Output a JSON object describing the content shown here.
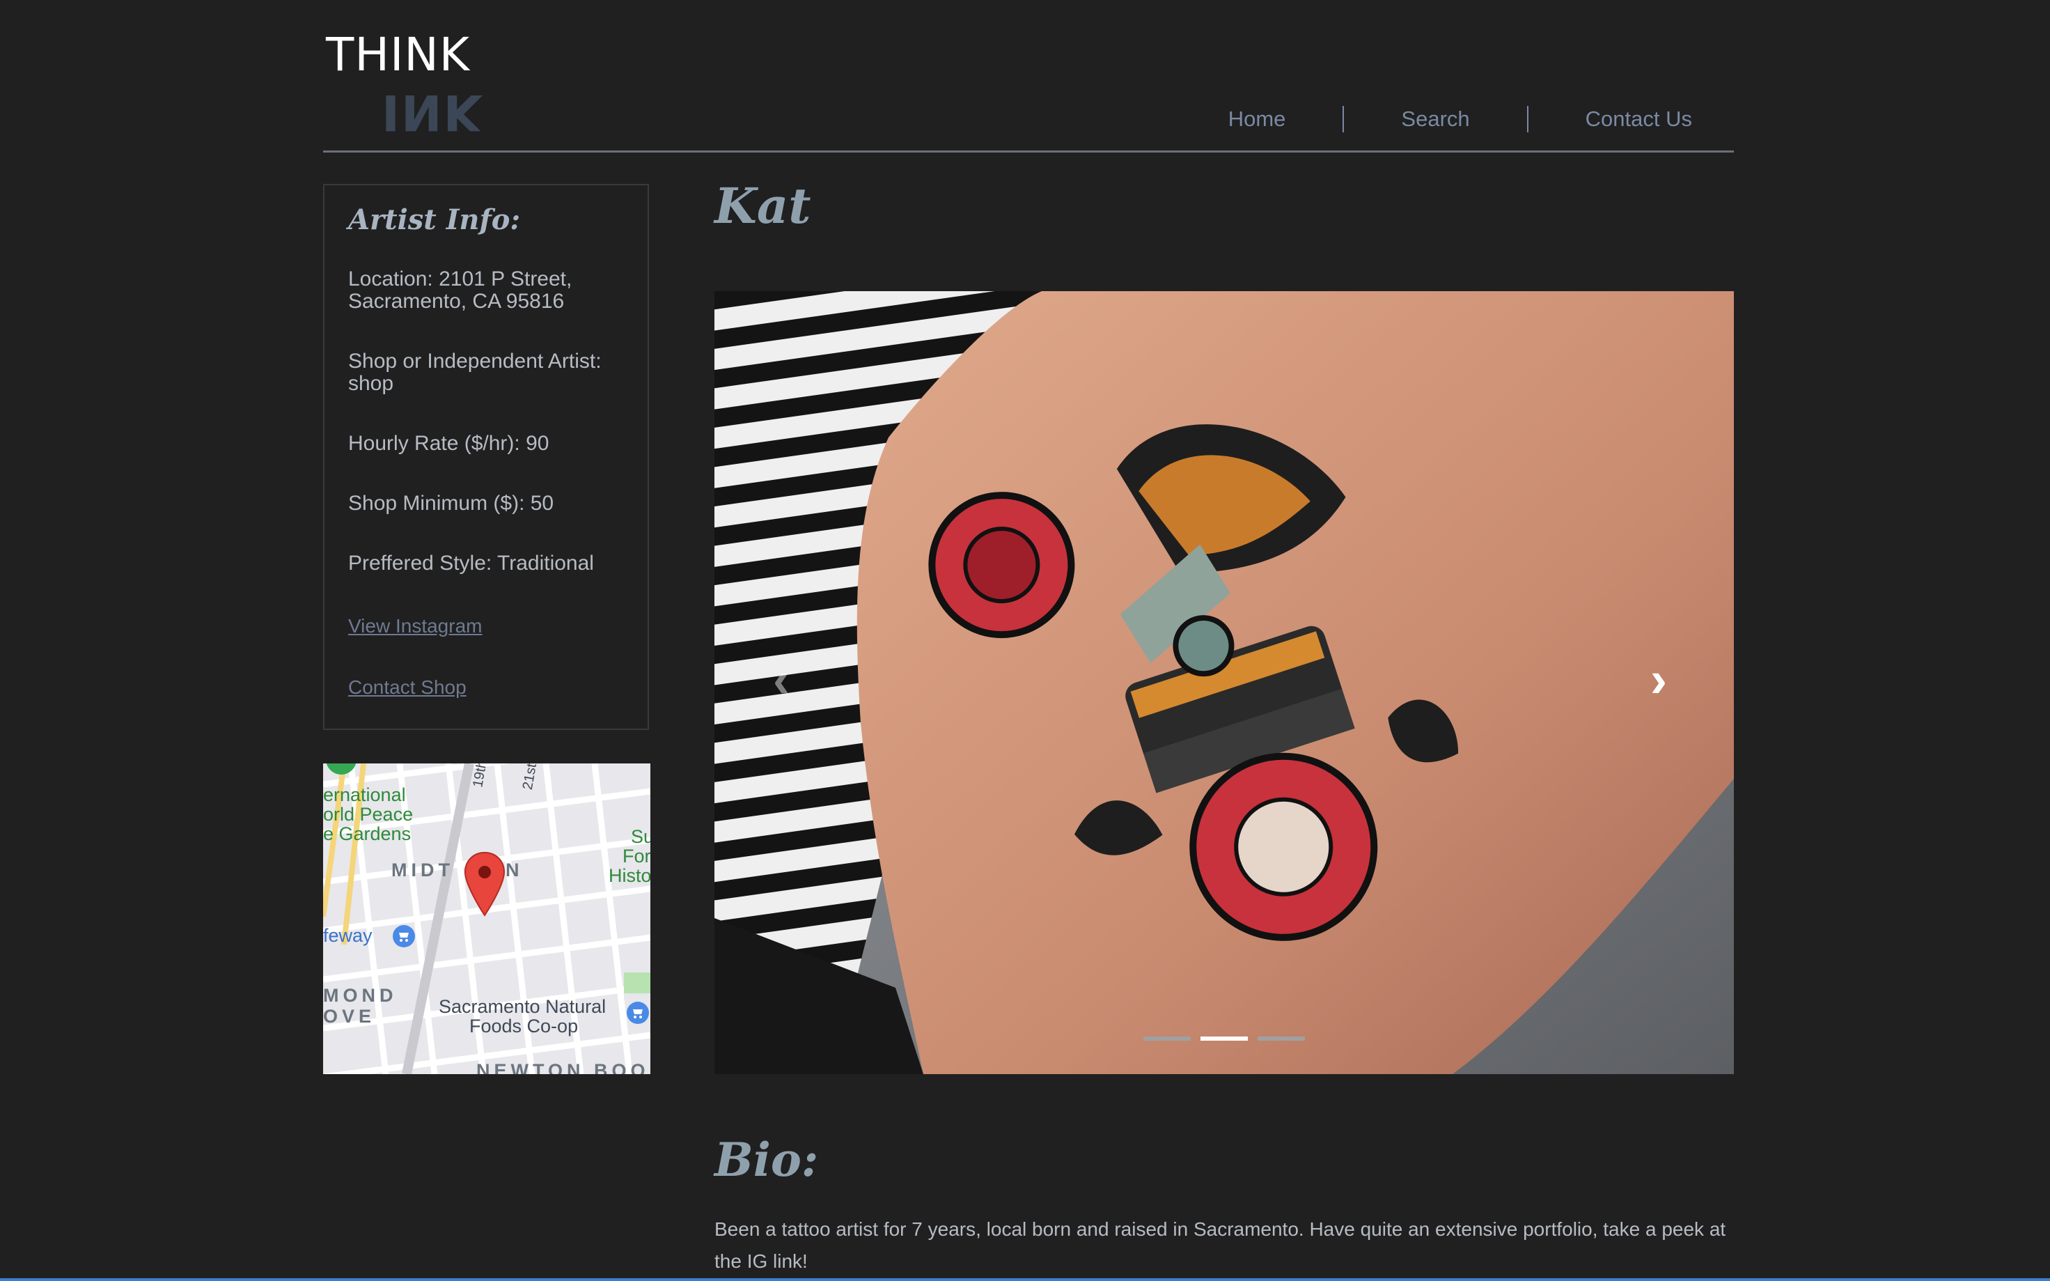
{
  "logo": {
    "top": "THINK",
    "bottom": "INK"
  },
  "nav": {
    "home": "Home",
    "search": "Search",
    "contact": "Contact Us"
  },
  "artist": {
    "name": "Kat"
  },
  "info": {
    "title": "Artist Info:",
    "location_1": "Location: 2101 P Street,",
    "location_2": "Sacramento, CA 95816",
    "shop_1": "Shop or Independent Artist:",
    "shop_2": "shop",
    "rate": "Hourly Rate ($/hr): 90",
    "minimum": "Shop Minimum ($): 50",
    "style": "Preffered Style: Traditional",
    "instagram_link": "View Instagram",
    "contact_link": "Contact Shop"
  },
  "map": {
    "labels": {
      "international": "ernational",
      "world_peace": "orld Peace",
      "rose_gardens": "e Gardens",
      "midtown": "MIDT",
      "midtown_end": "N",
      "safeway": "feway",
      "mond": "MOND",
      "ove": "OVE",
      "natural_foods_1": "Sacramento Natural",
      "natural_foods_2": "Foods Co-op",
      "newton": "NEWTON BOO",
      "su": "Su",
      "for": "For",
      "histo": "Histo",
      "street_19": "19th",
      "street_21": "21st"
    },
    "pin_icon": "map-pin-icon",
    "store_icon": "shopping-cart-icon"
  },
  "carousel": {
    "active_index": 1,
    "count": 3,
    "prev_icon": "chevron-left-icon",
    "next_icon": "chevron-right-icon"
  },
  "bio": {
    "title": "Bio:",
    "text": "Been a tattoo artist for 7 years, local born and raised in Sacramento. Have quite an extensive portfolio, take a peek at the IG link!"
  },
  "colors": {
    "background": "#202020",
    "nav_text": "#7a8aa4",
    "heading": "#8fa0ad",
    "link": "#6f7a91"
  }
}
